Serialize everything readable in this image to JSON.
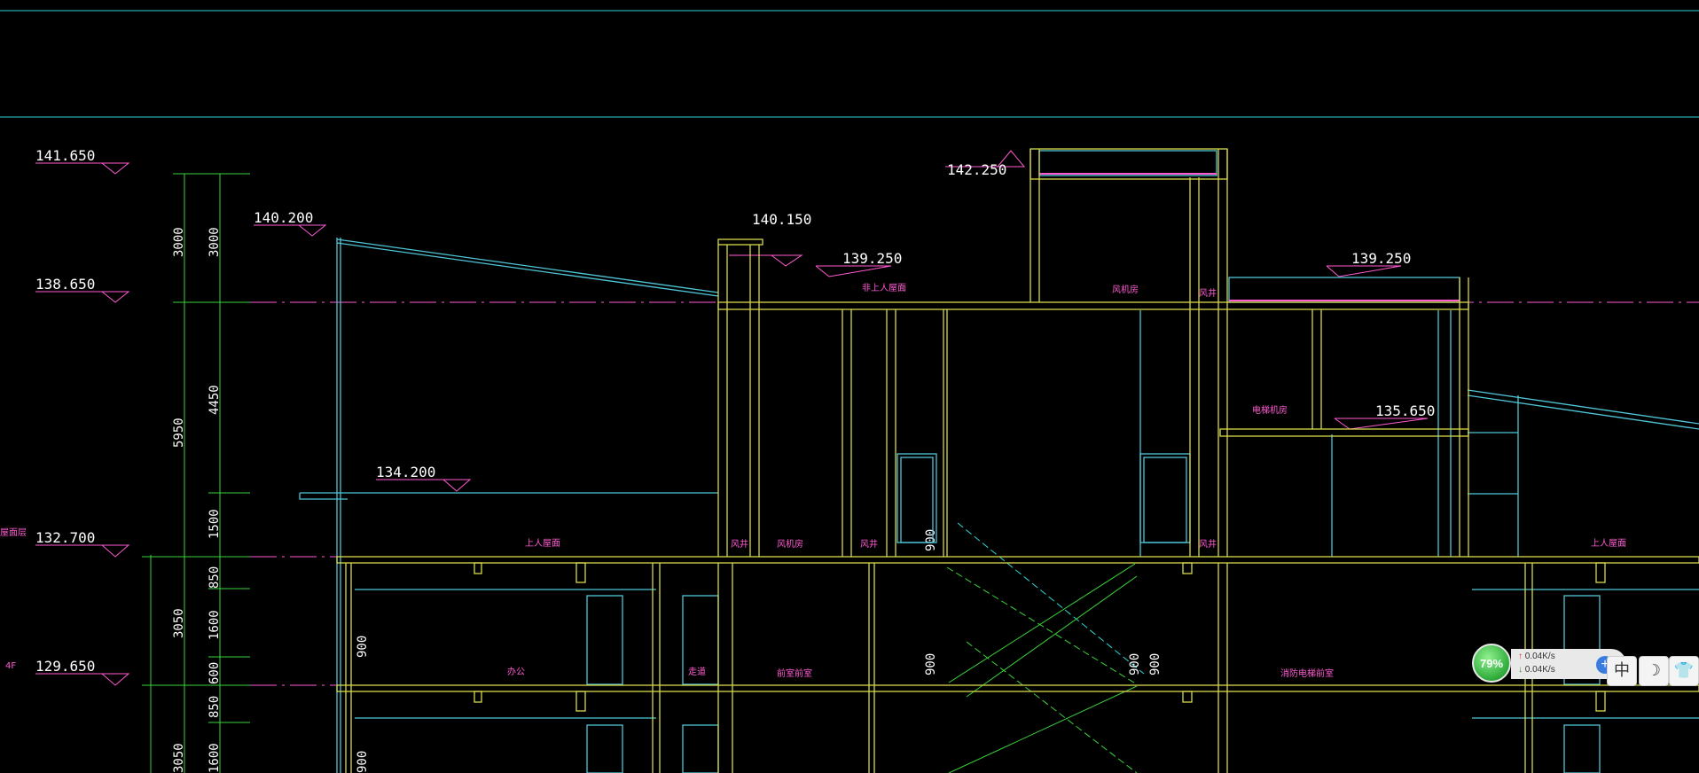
{
  "levels": {
    "l141_650": "141.650",
    "l138_650": "138.650",
    "l132_700": "132.700",
    "l129_650": "129.650",
    "l140_200": "140.200",
    "l140_150": "140.150",
    "l139_250a": "139.250",
    "l142_250": "142.250",
    "l139_250b": "139.250",
    "l134_200": "134.200",
    "l135_650": "135.650"
  },
  "floor_tags": {
    "roof": "屋面层",
    "f4": "4F"
  },
  "dimensions": {
    "d3000a": "3000",
    "d3000b": "3000",
    "d5950": "5950",
    "d4450": "4450",
    "d1500": "1500",
    "d850a": "850",
    "d3050a": "3050",
    "d1600a": "1600",
    "d600": "600",
    "d850b": "850",
    "d3050b": "3050",
    "d1600b": "1600",
    "d900a": "900",
    "d900b": "900",
    "d900c": "900",
    "d900d": "900",
    "d900e": "900",
    "d900f": "900"
  },
  "rooms": {
    "r_nonaccess_roof": "非上人屋面",
    "r_fan_room_top": "风机房",
    "r_shaft_top": "风井",
    "r_elevator_machine": "电梯机房",
    "r_access_roof_left": "上人屋面",
    "r_shaft1": "风井",
    "r_fan_room": "风机房",
    "r_shaft2": "风井",
    "r_shaft3": "风井",
    "r_access_roof_right": "上人屋面",
    "r_office": "办公",
    "r_corridor": "走道",
    "r_anteroom": "前室前室",
    "r_fire_lift_lobby": "消防电梯前室"
  },
  "widget": {
    "percent": "79%",
    "upload": "0.04K/s",
    "download": "0.04K/s",
    "up_arrow": "↑",
    "down_arrow": "↓",
    "plus": "+",
    "buttons": [
      {
        "icon": "chinese-input-icon",
        "glyph": "中"
      },
      {
        "icon": "moon-icon",
        "glyph": "☽"
      },
      {
        "icon": "shirt-icon",
        "glyph": "👕"
      }
    ]
  },
  "colors": {
    "background": "#000000",
    "wall": "#d8d84a",
    "outline": "#4fc6d8",
    "level_mark": "#ff5ad2",
    "dimension": "#3ad23a",
    "text": "#ffffff"
  }
}
